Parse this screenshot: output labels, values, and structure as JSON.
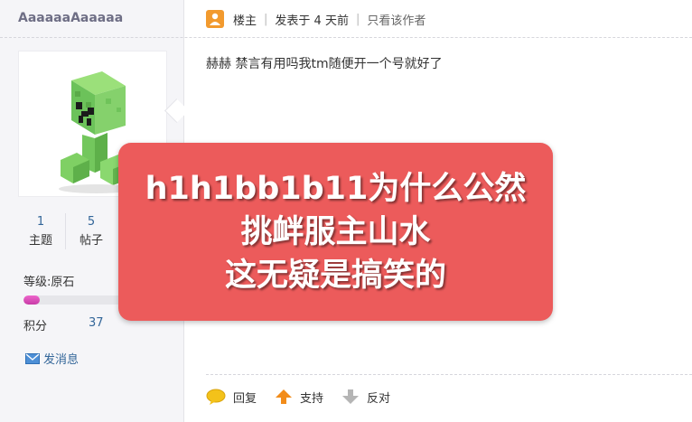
{
  "user": {
    "name": "AaaaaaAaaaaa",
    "stats": [
      {
        "value": "1",
        "label": "主题"
      },
      {
        "value": "5",
        "label": "帖子"
      }
    ],
    "level_label": "等级:原石",
    "level_progress": 0.15,
    "points_label": "积分",
    "points_value": "37",
    "message_label": "发消息"
  },
  "post": {
    "author_badge": "楼主",
    "posted": "发表于 4 天前",
    "only_author": "只看该作者",
    "content": "赫赫 禁言有用吗我tm随便开一个号就好了"
  },
  "actions": {
    "reply": "回复",
    "support": "支持",
    "oppose": "反对"
  },
  "overlay": {
    "lines": [
      "h1h1bb1b11为什么公然",
      "挑衅服主山水",
      "这无疑是搞笑的"
    ]
  },
  "colors": {
    "overlay_bg": "#ec5b5b",
    "link": "#336699",
    "level_bar": "#d94fb8"
  },
  "icons": {
    "author": "author-icon",
    "message": "mail-icon",
    "reply": "speech-bubble-icon",
    "support": "thumb-up-arrow-icon",
    "oppose": "thumb-down-arrow-icon"
  }
}
